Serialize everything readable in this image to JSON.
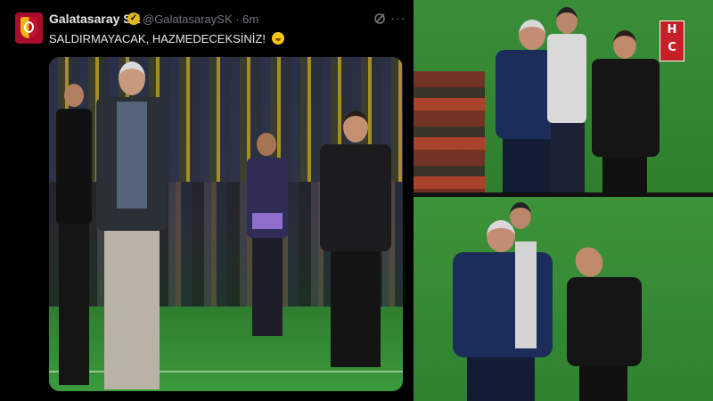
{
  "tweet": {
    "display_name": "Galatasaray SK",
    "handle_time": "@GalatasaraySK · 6m",
    "text": "SALDIRMAYACAK, HAZMEDECEKSİNİZ!",
    "emoji_icon": "face-with-open-mouth-emoji",
    "more_symbol": "···"
  },
  "icons": {
    "verified": "verified-badge-icon",
    "grok": "grok-icon",
    "more": "more-options-icon"
  },
  "watermark": {
    "logo_text": "HC"
  },
  "colors": {
    "background": "#000000",
    "text_primary": "#e7e9ea",
    "text_secondary": "#71767b",
    "verified_gold": "#e2b719",
    "pitch_green": "#3a9a3c",
    "galatasaray_red": "#a90d2b",
    "watermark_red": "#c62026"
  }
}
